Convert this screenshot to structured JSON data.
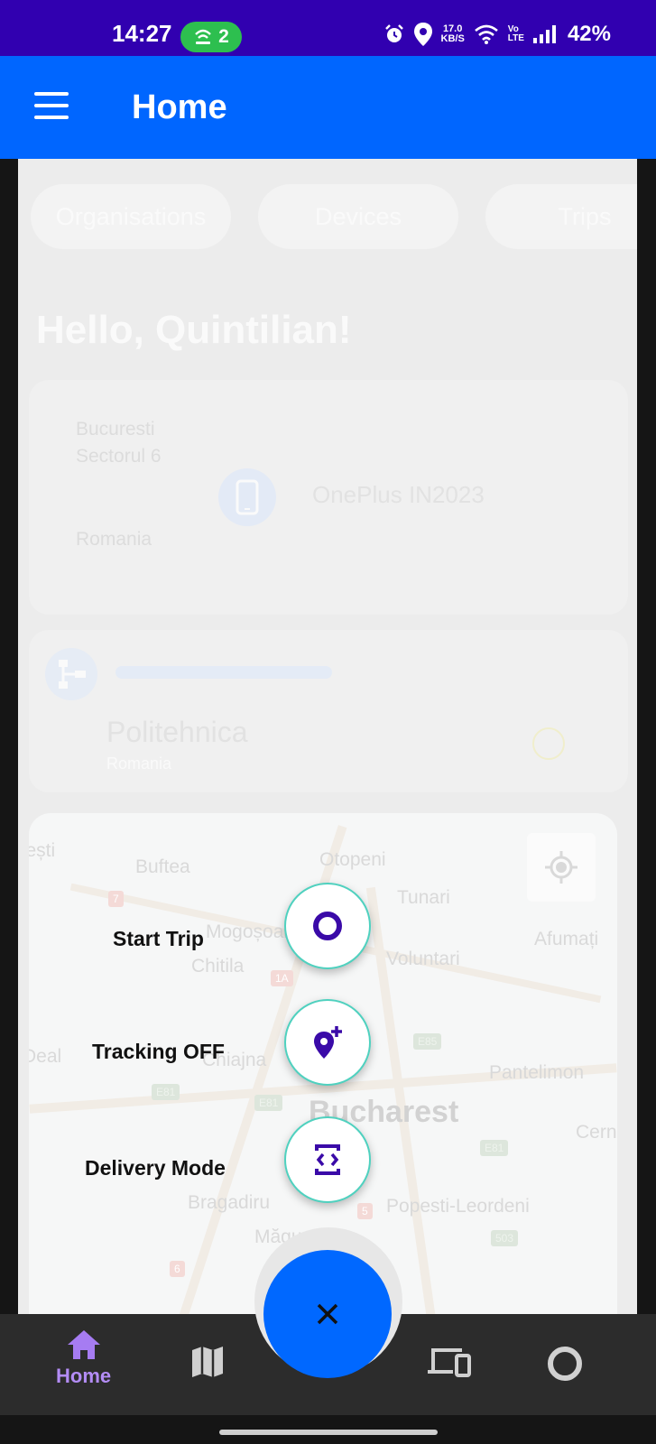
{
  "status_bar": {
    "time": "14:27",
    "hotspot_count": "2",
    "net_speed_value": "17.0",
    "net_speed_unit": "KB/S",
    "volte_top": "Vo",
    "volte_bottom": "LTE",
    "battery": "42%"
  },
  "app_bar": {
    "title": "Home",
    "menu_icon": "hamburger-icon"
  },
  "tabs": [
    {
      "label": "Organisations"
    },
    {
      "label": "Devices"
    },
    {
      "label": "Trips"
    }
  ],
  "greeting": "Hello, Quintilian!",
  "device_card": {
    "location_line1": "Bucuresti",
    "location_line2": "Sectorul 6",
    "country": "Romania",
    "device_name": "OnePlus IN2023",
    "icon": "phone-icon"
  },
  "org_card": {
    "name": "Politehnica",
    "country": "Romania",
    "icon": "sitemap-icon"
  },
  "map": {
    "labels": [
      "Buftea",
      "Otopeni",
      "Tunari",
      "Mogoșoaia",
      "Afumați",
      "Chitila",
      "Voluntari",
      "Chiajna",
      "Pantelimon",
      "Bucharest",
      "Bragadiru",
      "Popesti-Leordeni",
      "Măgurele",
      "-Deal",
      "Cern",
      "șești"
    ],
    "road_badges": [
      "7",
      "1A",
      "E85",
      "E81",
      "E81",
      "E81",
      "5",
      "6",
      "503"
    ]
  },
  "fab_menu": {
    "items": [
      {
        "label": "Start Trip",
        "icon": "circle-outline-icon"
      },
      {
        "label": "Tracking OFF",
        "icon": "location-plus-icon"
      },
      {
        "label": "Delivery Mode",
        "icon": "code-box-icon"
      }
    ],
    "close_icon": "close-icon"
  },
  "bottom_nav": {
    "items": [
      {
        "label": "Home",
        "icon": "home-icon",
        "active": true
      },
      {
        "label": "",
        "icon": "map-icon"
      },
      {
        "label": "",
        "icon": "devices-icon"
      },
      {
        "label": "",
        "icon": "circle-icon"
      }
    ]
  },
  "colors": {
    "status_bar": "#3100b0",
    "app_bar": "#0066ff",
    "fab": "#0068ff",
    "accent_purple": "#3a0aa8",
    "active_nav": "#b38cf5"
  }
}
